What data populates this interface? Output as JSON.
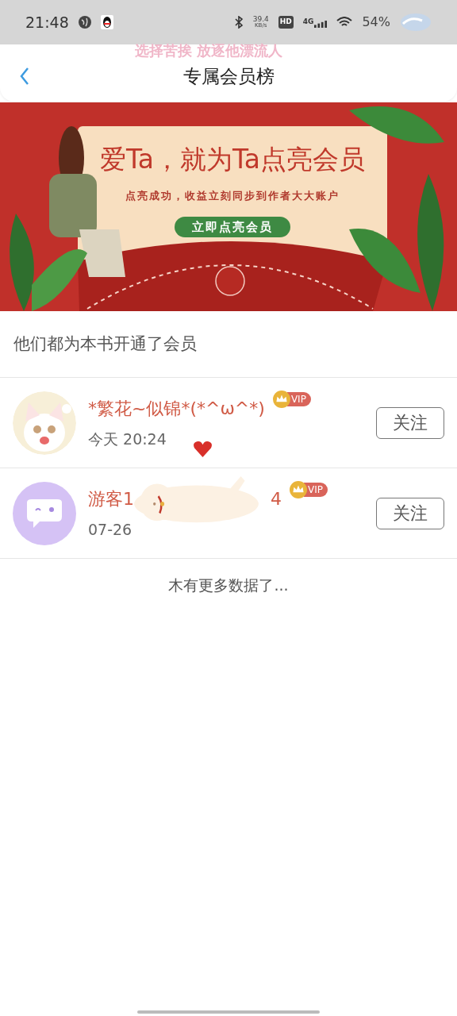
{
  "status_bar": {
    "time": "21:48",
    "speed": "39.4",
    "speed_unit": "KB/s",
    "hd": "HD",
    "network": "4G",
    "battery": "54%"
  },
  "lyric_overlay": "选择苦挨 放逐他漂流人",
  "header": {
    "title": "专属会员榜"
  },
  "banner": {
    "headline": "爱Ta，就为Ta点亮会员",
    "subtitle": "点亮成功，收益立刻同步到作者大大账户",
    "button": "立即点亮会员"
  },
  "section_title": "他们都为本书开通了会员",
  "members": [
    {
      "kind": "illustrated",
      "name": "*繁花~似锦*(*^ω^*)",
      "vip_label": "VIP",
      "time": "今天 20:24",
      "follow": "关注"
    },
    {
      "kind": "default",
      "name": "游客1",
      "name_tail": "4",
      "vip_label": "VIP",
      "time": "07-26",
      "follow": "关注"
    }
  ],
  "footer": "木有更多数据了..."
}
